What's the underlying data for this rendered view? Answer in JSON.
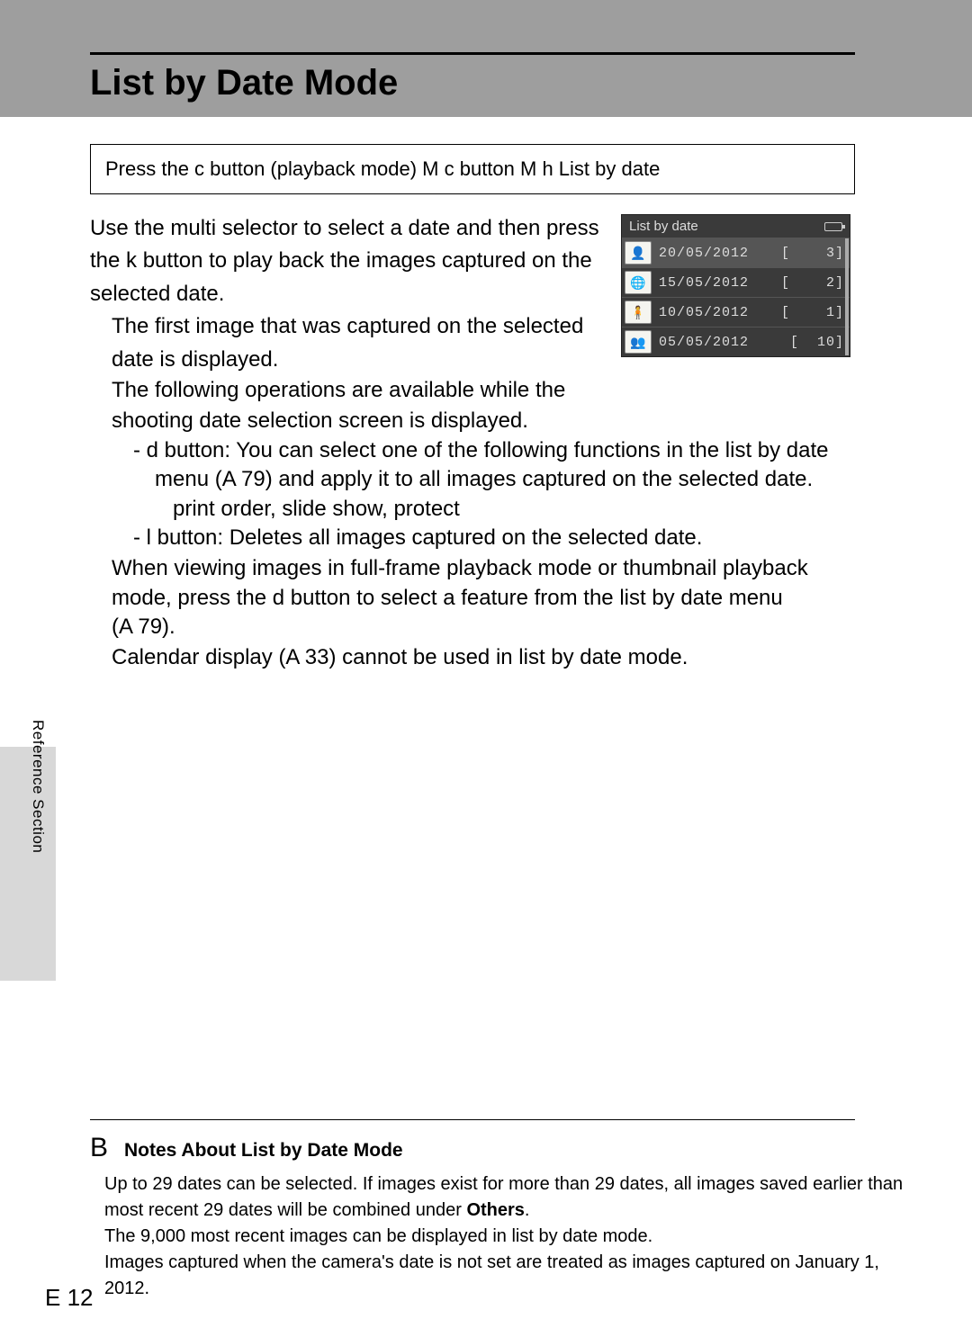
{
  "header": {
    "title": "List by Date Mode"
  },
  "breadcrumb": {
    "text": "Press the c   button (playback mode) M c   button M h   List by date"
  },
  "lcd": {
    "header": "List by date",
    "rows": [
      {
        "date": "20/05/2012",
        "count": "[    3]"
      },
      {
        "date": "15/05/2012",
        "count": "[    2]"
      },
      {
        "date": "10/05/2012",
        "count": "[    1]"
      },
      {
        "date": "05/05/2012",
        "count": "[  10]"
      }
    ],
    "thumbs": [
      "👤",
      "🌐",
      "🧍",
      "👥"
    ]
  },
  "body": {
    "p1a": "Use the multi selector to select a date and then press",
    "p1b": "the k   button to play back the images captured on the",
    "p1c": "selected date.",
    "b1a": "The first image that was captured on the selected",
    "b1b": "date is displayed.",
    "b2a": "The following operations are available while the",
    "b2b": "shooting date selection screen is displayed.",
    "s1a": "-   d      button: You can select one of the following functions in the list by date",
    "s1b": "menu (A  79) and apply it to all images captured on the selected date.",
    "s1c": "print order, slide show, protect",
    "s2": "-   l   button: Deletes all images captured on the selected date.",
    "b3a": "When viewing images in full-frame playback mode or thumbnail playback",
    "b3b": "mode, press the d     button to select a feature from the list by date menu",
    "b3c": "(A  79).",
    "b4": "Calendar display (A  33) cannot be used in list by date mode."
  },
  "side": {
    "label": "Reference Section"
  },
  "notes": {
    "icon": "B",
    "title": "Notes About List by Date Mode",
    "n1a": "Up to 29 dates can be selected. If images exist for more than 29 dates, all images saved earlier than",
    "n1b_pre": "most recent 29 dates will be combined under ",
    "n1b_bold": "Others",
    "n1b_post": ".",
    "n2": "The 9,000 most recent images can be displayed in list by date mode.",
    "n3a": "Images captured when the camera's date is not set are treated as images captured on January 1,",
    "n3b": "2012."
  },
  "page": {
    "label": "E  12"
  }
}
